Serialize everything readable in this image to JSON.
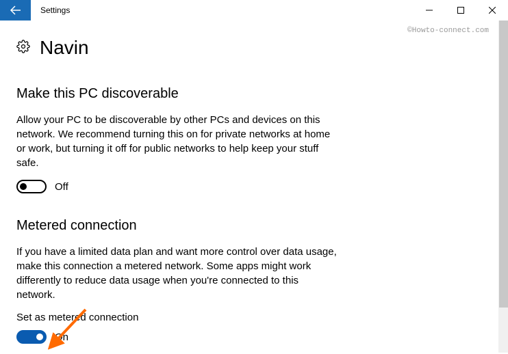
{
  "titlebar": {
    "back_aria": "Back",
    "title": "Settings"
  },
  "watermark": "©Howto-connect.com",
  "page": {
    "title": "Navin"
  },
  "discoverable": {
    "heading": "Make this PC discoverable",
    "description": "Allow your PC to be discoverable by other PCs and devices on this network. We recommend turning this on for private networks at home or work, but turning it off for public networks to help keep your stuff safe.",
    "toggle_state": "Off"
  },
  "metered": {
    "heading": "Metered connection",
    "description": "If you have a limited data plan and want more control over data usage, make this connection a metered network. Some apps might work differently to reduce data usage when you're connected to this network.",
    "sub_label": "Set as metered connection",
    "toggle_state": "On"
  }
}
